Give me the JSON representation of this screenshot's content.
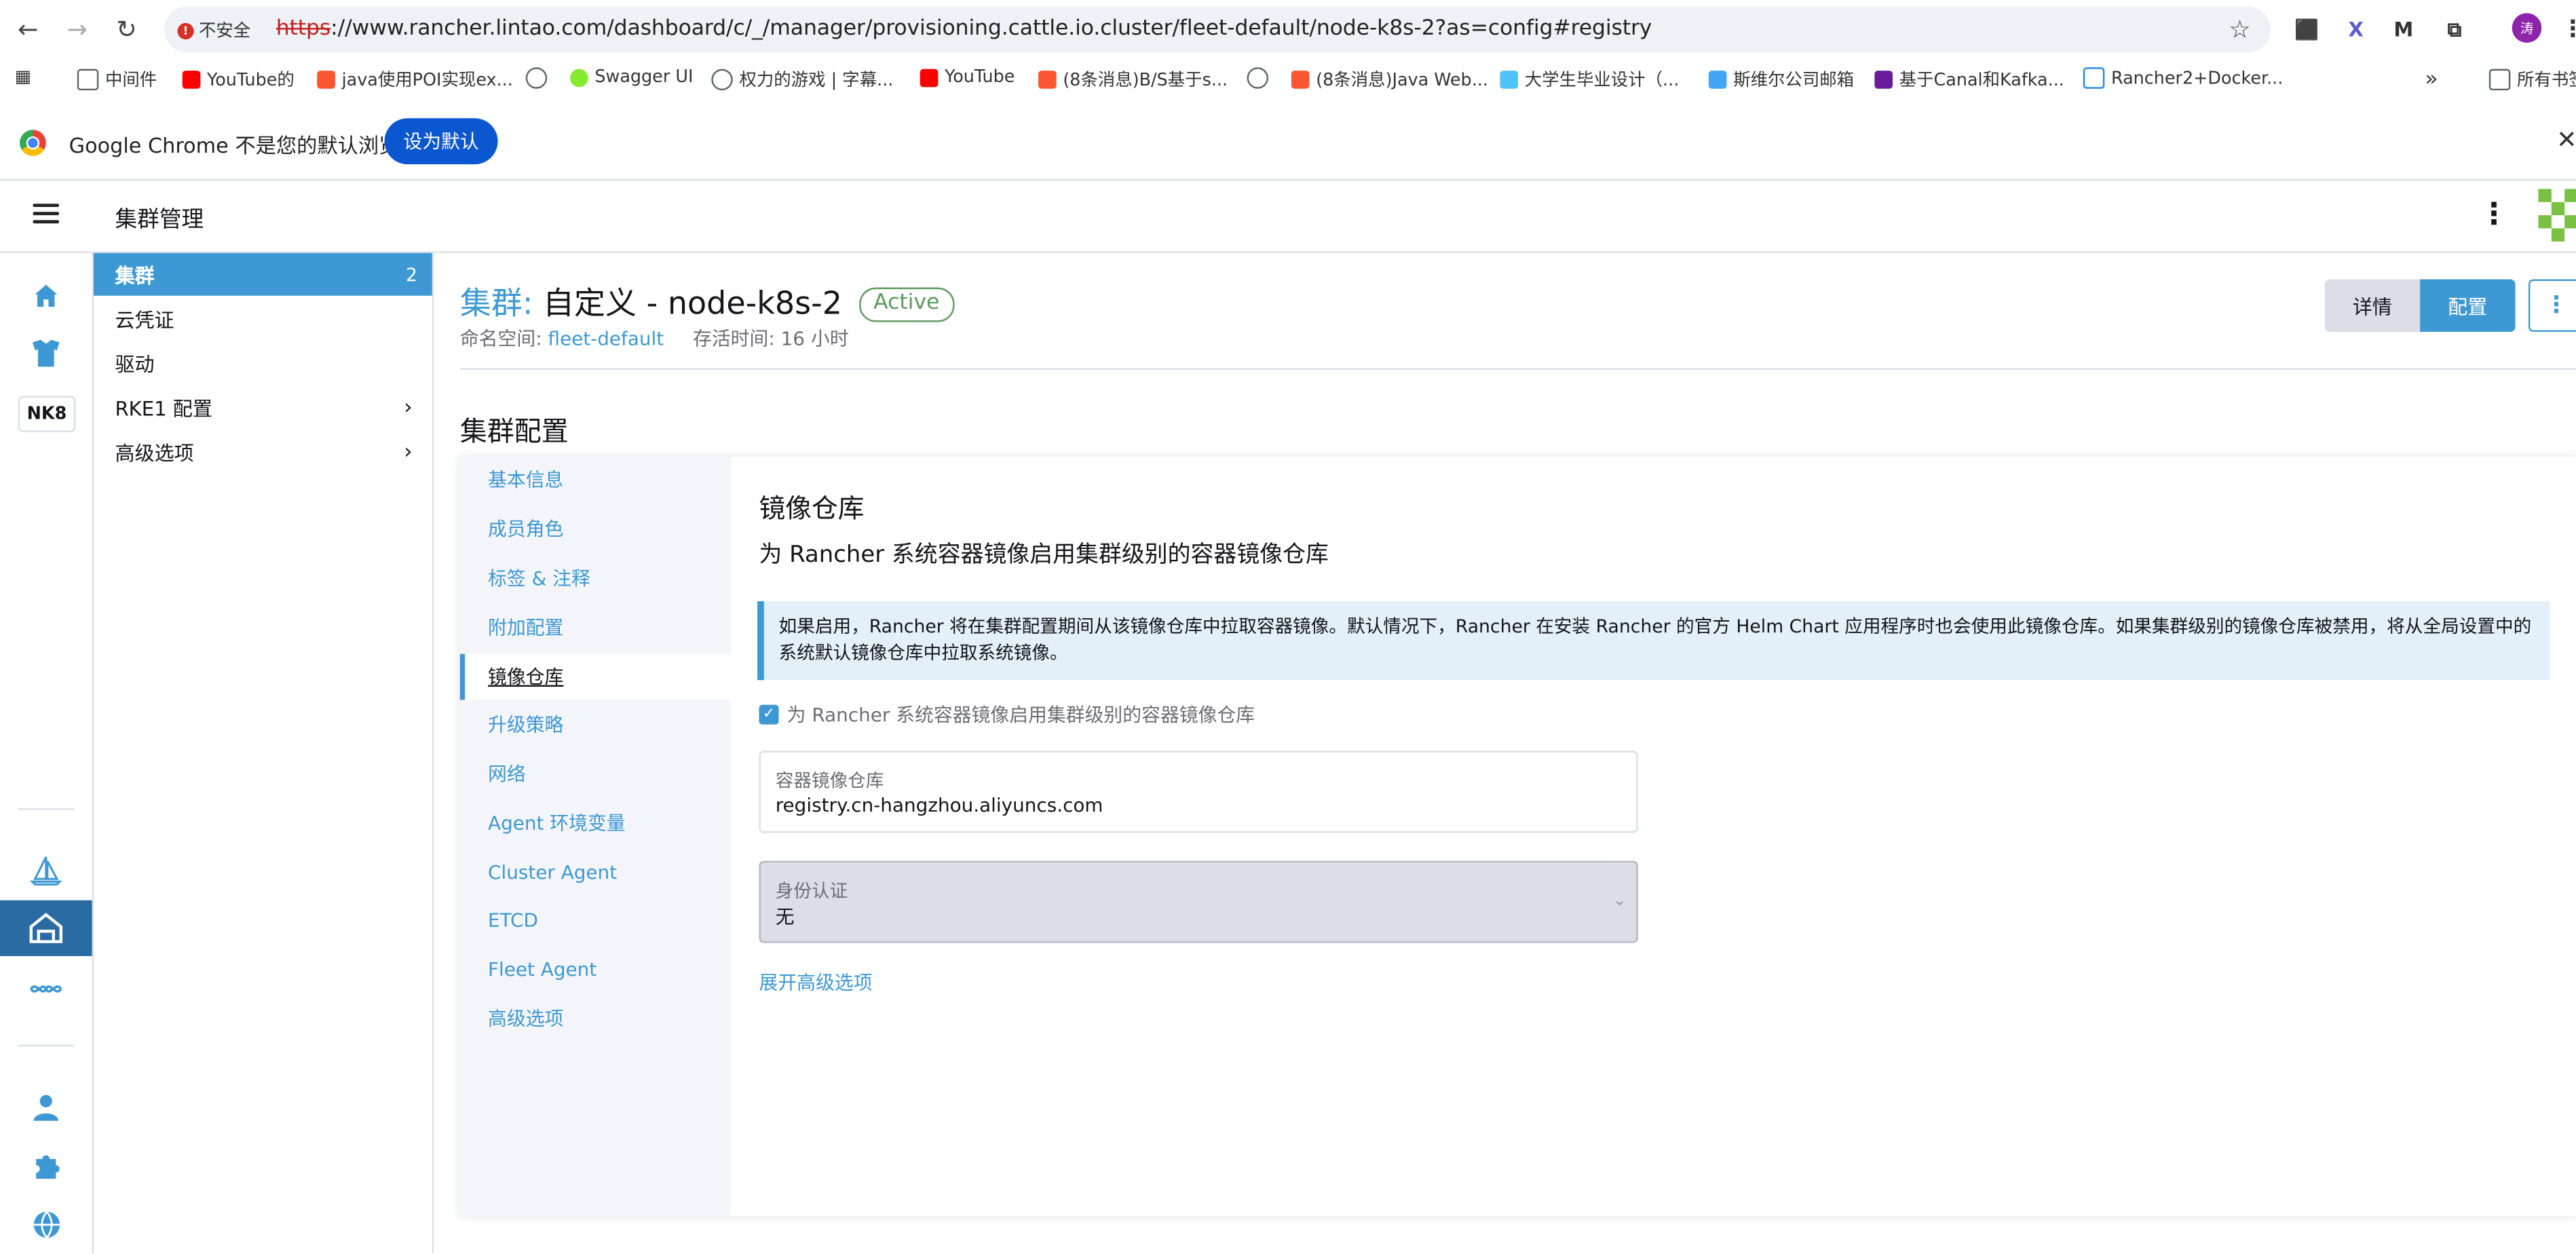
{
  "browser": {
    "insecure_label": "不安全",
    "url_scheme": "https",
    "url_rest": "://www.rancher.lintao.com/dashboard/c/_/manager/provisioning.cattle.io.cluster/fleet-default/node-k8s-2?as=config#registry",
    "ext_labels": [
      "⬛",
      "X",
      "M",
      "⧉"
    ],
    "profile_initial": "涛"
  },
  "bookmarks": [
    {
      "label": "中间件",
      "color": "#5f6368"
    },
    {
      "label": "YouTube的",
      "color": "#ff0000"
    },
    {
      "label": "java使用POI实现ex...",
      "color": "#fc5531"
    },
    {
      "label": "",
      "color": "#5f6368"
    },
    {
      "label": "Swagger UI",
      "color": "#85ea2d"
    },
    {
      "label": "权力的游戏 | 字幕...",
      "color": "#5f6368"
    },
    {
      "label": "YouTube",
      "color": "#ff0000"
    },
    {
      "label": "(8条消息)B/S基于s...",
      "color": "#fc5531"
    },
    {
      "label": "",
      "color": "#5f6368"
    },
    {
      "label": "(8条消息)Java Web...",
      "color": "#fc5531"
    },
    {
      "label": "大学生毕业设计（...",
      "color": "#4fc3f7"
    },
    {
      "label": "斯维尔公司邮箱",
      "color": "#42a5f5"
    },
    {
      "label": "基于Canal和Kafka...",
      "color": "#6a1b9a"
    },
    {
      "label": "Rancher2+Docker...",
      "color": "#1e88e5"
    }
  ],
  "bookmarks_overflow": "»",
  "bookmarks_all": "所有书签",
  "infobar": {
    "text": "Google Chrome 不是您的默认浏览器",
    "button": "设为默认"
  },
  "app": {
    "title": "集群管理"
  },
  "rail": {
    "cluster_badge": "NK8"
  },
  "sidenav": {
    "items": [
      {
        "label": "集群",
        "count": "2"
      },
      {
        "label": "云凭证"
      },
      {
        "label": "驱动"
      },
      {
        "label": "RKE1 配置"
      },
      {
        "label": "高级选项"
      }
    ]
  },
  "cluster": {
    "title_lead": "集群:",
    "title_name": "自定义 - node-k8s-2",
    "status": "Active",
    "ns_label": "命名空间:",
    "ns_value": "fleet-default",
    "age_label": "存活时间: 16 小时",
    "btn_detail": "详情",
    "btn_config": "配置"
  },
  "section": {
    "title": "集群配置"
  },
  "tabs": [
    "基本信息",
    "成员角色",
    "标签 & 注释",
    "附加配置",
    "镜像仓库",
    "升级策略",
    "网络",
    "Agent 环境变量",
    "Cluster Agent",
    "ETCD",
    "Fleet Agent",
    "高级选项"
  ],
  "registry": {
    "title": "镜像仓库",
    "subtitle": "为 Rancher 系统容器镜像启用集群级别的容器镜像仓库",
    "banner": "如果启用，Rancher 将在集群配置期间从该镜像仓库中拉取容器镜像。默认情况下，Rancher 在安装 Rancher 的官方 Helm Chart 应用程序时也会使用此镜像仓库。如果集群级别的镜像仓库被禁用，将从全局设置中的系统默认镜像仓库中拉取系统镜像。",
    "checkbox_label": "为 Rancher 系统容器镜像启用集群级别的容器镜像仓库",
    "checkbox_checked": true,
    "registry_label": "容器镜像仓库",
    "registry_value": "registry.cn-hangzhou.aliyuncs.com",
    "auth_label": "身份认证",
    "auth_value": "无",
    "advanced_link": "展开高级选项"
  },
  "colors": {
    "accent": "#3d98d3",
    "active_badge": "#5d995d",
    "rail_active": "#2a6ba3"
  }
}
